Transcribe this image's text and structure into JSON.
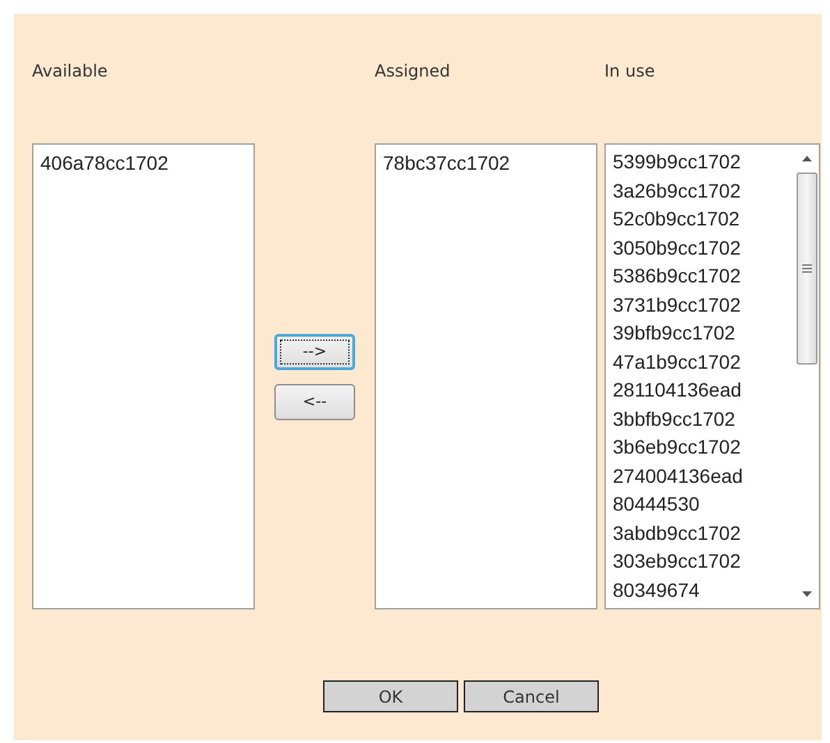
{
  "columns": [
    {
      "label": "Available",
      "items": [
        "406a78cc1702"
      ],
      "scrollbar": false
    },
    {
      "label": "Assigned",
      "items": [
        "78bc37cc1702"
      ],
      "scrollbar": false
    },
    {
      "label": "In use",
      "items": [
        "5399b9cc1702",
        "3a26b9cc1702",
        "52c0b9cc1702",
        "3050b9cc1702",
        "5386b9cc1702",
        "3731b9cc1702",
        "39bfb9cc1702",
        "47a1b9cc1702",
        "281104136ead",
        "3bbfb9cc1702",
        "3b6eb9cc1702",
        "274004136ead",
        "80444530",
        "3abdb9cc1702",
        "303eb9cc1702",
        "80349674"
      ],
      "scrollbar": true
    }
  ],
  "move_buttons": [
    {
      "label": "-->",
      "focused": true
    },
    {
      "label": "<--",
      "focused": false
    }
  ],
  "dialog_buttons": [
    "OK",
    "Cancel"
  ]
}
